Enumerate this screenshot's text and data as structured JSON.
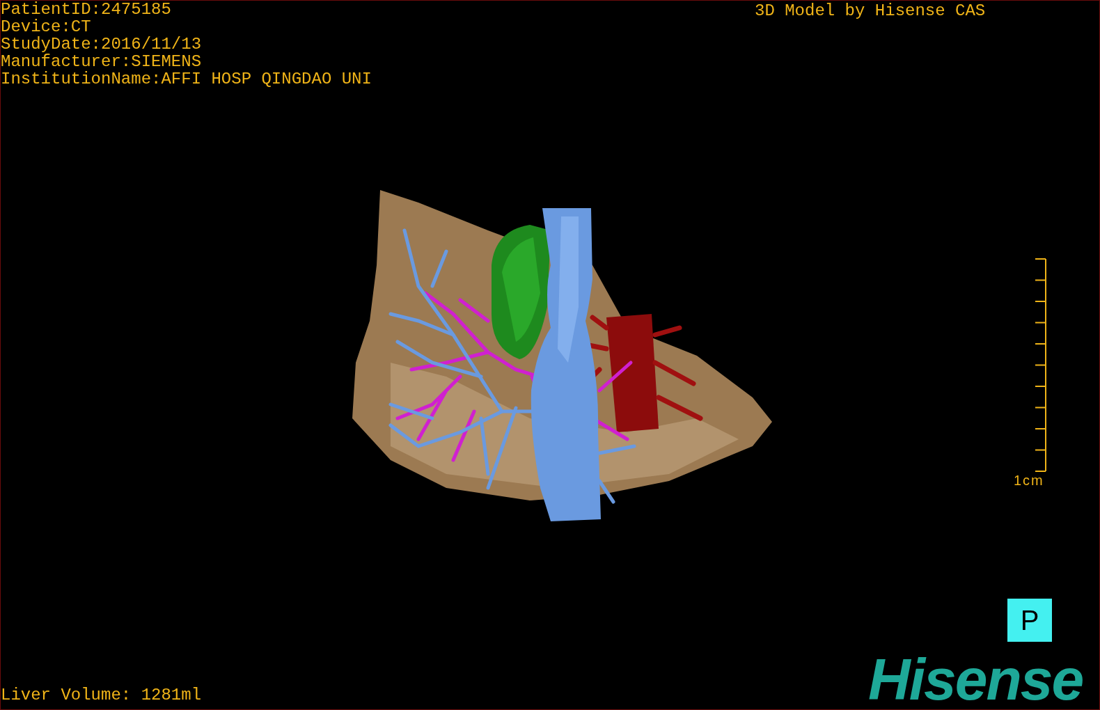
{
  "patient_info": [
    "PatientID:2475185",
    "Device:CT",
    "StudyDate:2016/11/13",
    "Manufacturer:SIEMENS",
    "InstitutionName:AFFI HOSP QINGDAO UNI"
  ],
  "title": "3D Model by Hisense CAS",
  "scale_bar": {
    "label": "1cm"
  },
  "orientation": "P",
  "liver_volume": "Liver Volume: 1281ml",
  "logo": "Hisense"
}
